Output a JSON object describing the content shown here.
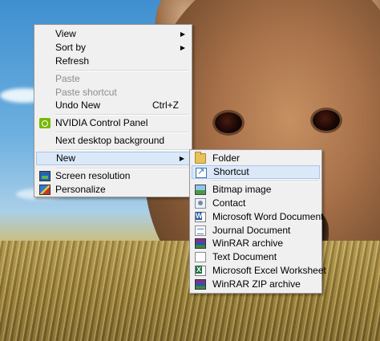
{
  "context_menu": {
    "items": [
      {
        "label": "View",
        "submenu": true
      },
      {
        "label": "Sort by",
        "submenu": true
      },
      {
        "label": "Refresh"
      },
      {
        "label": "Paste",
        "disabled": true
      },
      {
        "label": "Paste shortcut",
        "disabled": true
      },
      {
        "label": "Undo New",
        "shortcut": "Ctrl+Z"
      },
      {
        "label": "NVIDIA Control Panel",
        "icon": "nvidia-icon"
      },
      {
        "label": "Next desktop background"
      },
      {
        "label": "New",
        "submenu": true,
        "highlighted": true
      },
      {
        "label": "Screen resolution",
        "icon": "screen-resolution-icon"
      },
      {
        "label": "Personalize",
        "icon": "personalize-icon"
      }
    ],
    "submenu_arrow": "▶"
  },
  "new_submenu": {
    "items": [
      {
        "label": "Folder",
        "icon": "folder-icon"
      },
      {
        "label": "Shortcut",
        "icon": "shortcut-icon",
        "highlighted": true
      },
      {
        "label": "Bitmap image",
        "icon": "bitmap-image-icon"
      },
      {
        "label": "Contact",
        "icon": "contact-icon"
      },
      {
        "label": "Microsoft Word Document",
        "icon": "word-document-icon"
      },
      {
        "label": "Journal Document",
        "icon": "journal-document-icon"
      },
      {
        "label": "WinRAR archive",
        "icon": "winrar-archive-icon"
      },
      {
        "label": "Text Document",
        "icon": "text-document-icon"
      },
      {
        "label": "Microsoft Excel Worksheet",
        "icon": "excel-worksheet-icon"
      },
      {
        "label": "WinRAR ZIP archive",
        "icon": "winrar-zip-icon"
      }
    ]
  },
  "colors": {
    "menu_background": "#f0f0f0",
    "menu_border": "#979797",
    "highlight_background": "#dbe8f8",
    "highlight_border": "#a8c8ee",
    "disabled_text": "#8d8d8d"
  }
}
